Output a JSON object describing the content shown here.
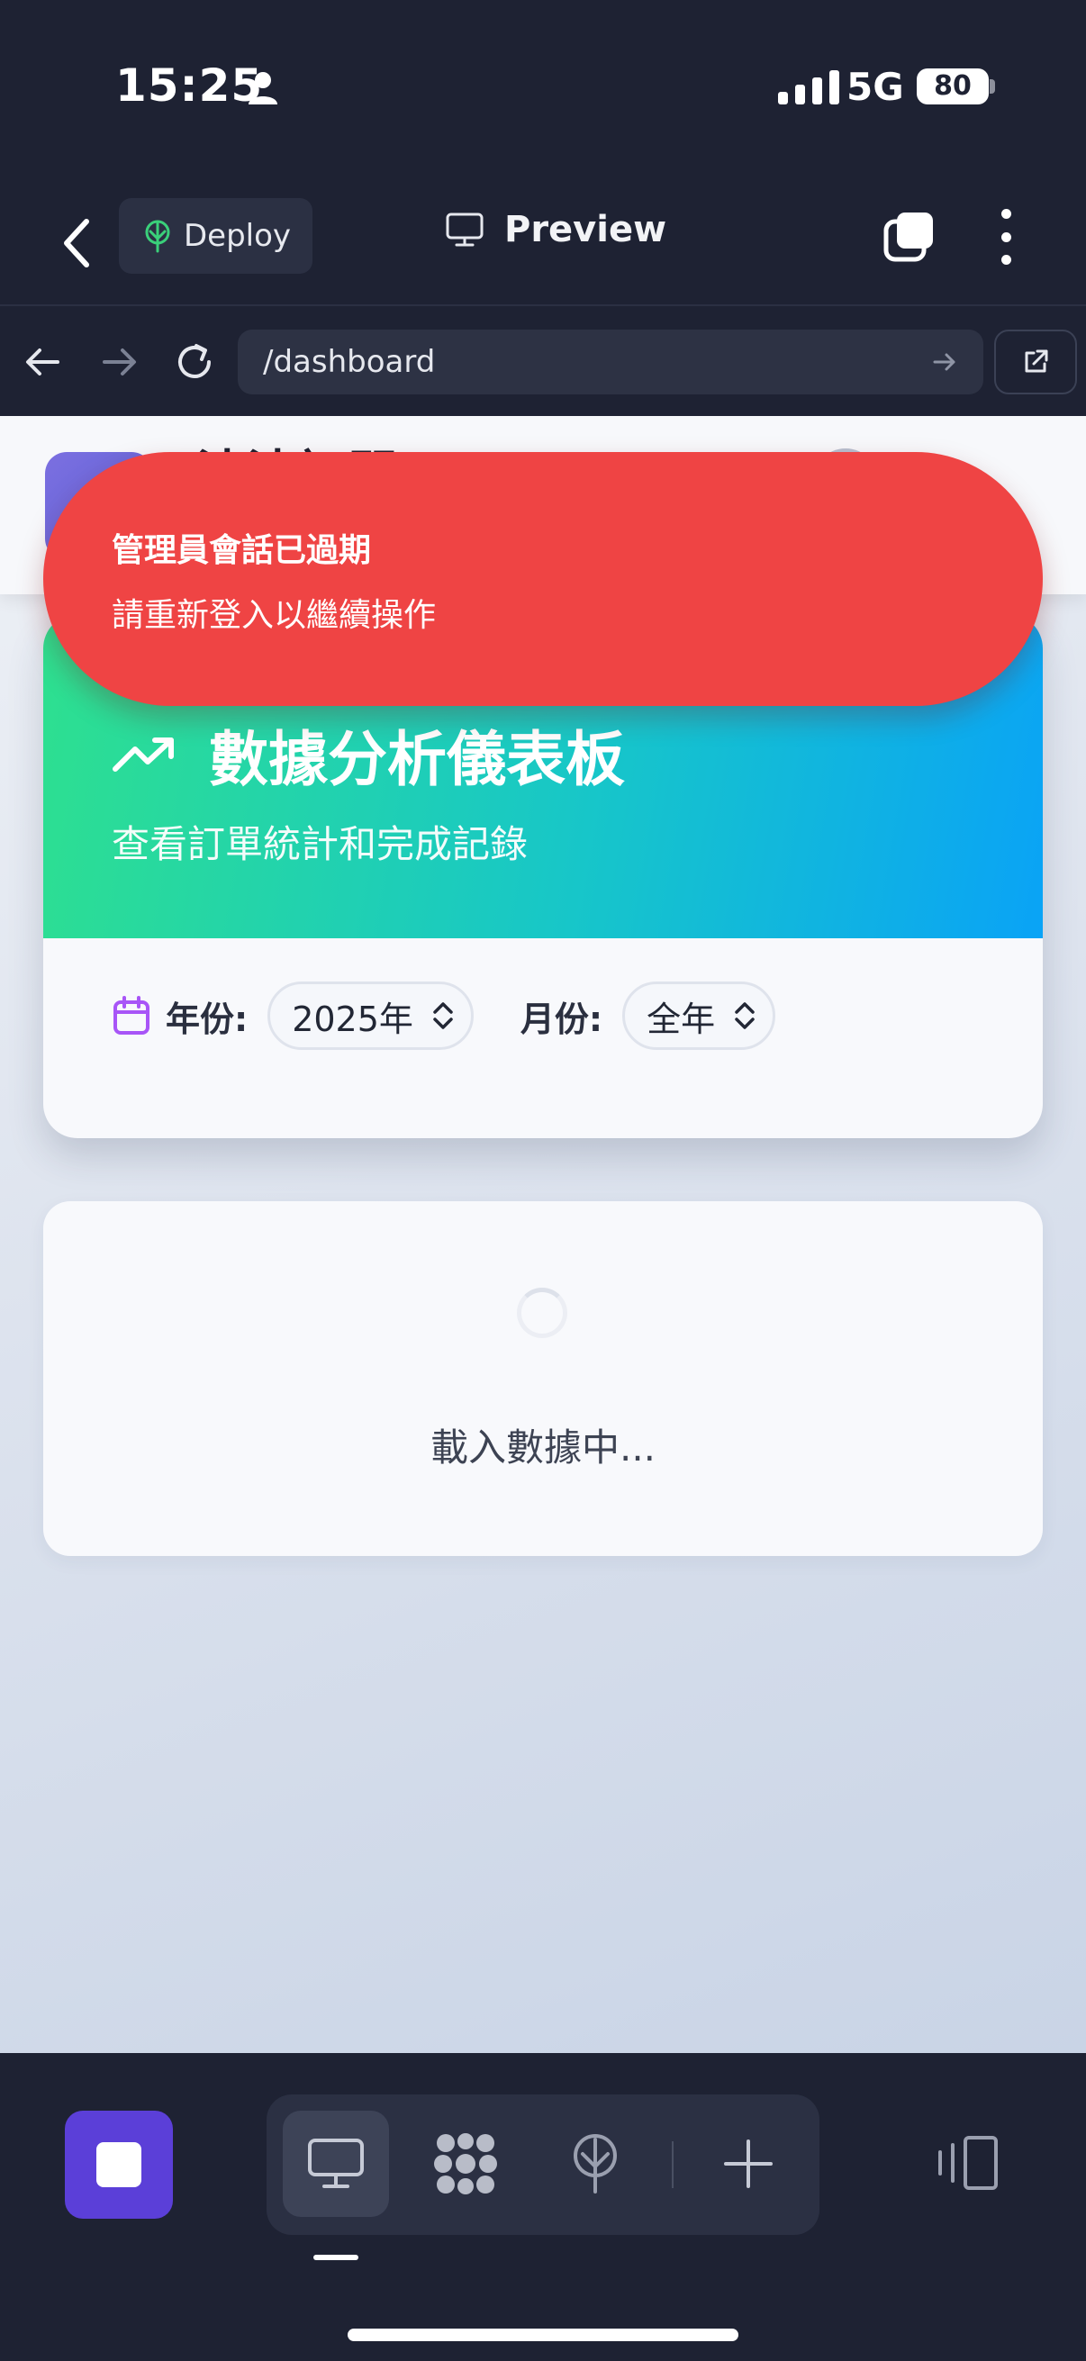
{
  "status_bar": {
    "time": "15:25",
    "network": "5G",
    "battery": "80"
  },
  "app_header": {
    "deploy_label": "Deploy",
    "preview_label": "Preview"
  },
  "url_bar": {
    "url": "/dashboard"
  },
  "site_header": {
    "title": "清清訂閱"
  },
  "dashboard": {
    "title": "數據分析儀表板",
    "subtitle": "查看訂單統計和完成記錄",
    "year_label": "年份:",
    "year_value": "2025年",
    "month_label": "月份:",
    "month_value": "全年"
  },
  "loading": {
    "text": "載入數據中..."
  },
  "toast": {
    "title": "管理員會話已過期",
    "message": "請重新登入以繼續操作"
  },
  "colors": {
    "toast_bg": "#ef4444",
    "accent_purple": "#5b3fd8",
    "hero_gradient_start": "#2ee08f",
    "hero_gradient_end": "#0aa3f6"
  }
}
